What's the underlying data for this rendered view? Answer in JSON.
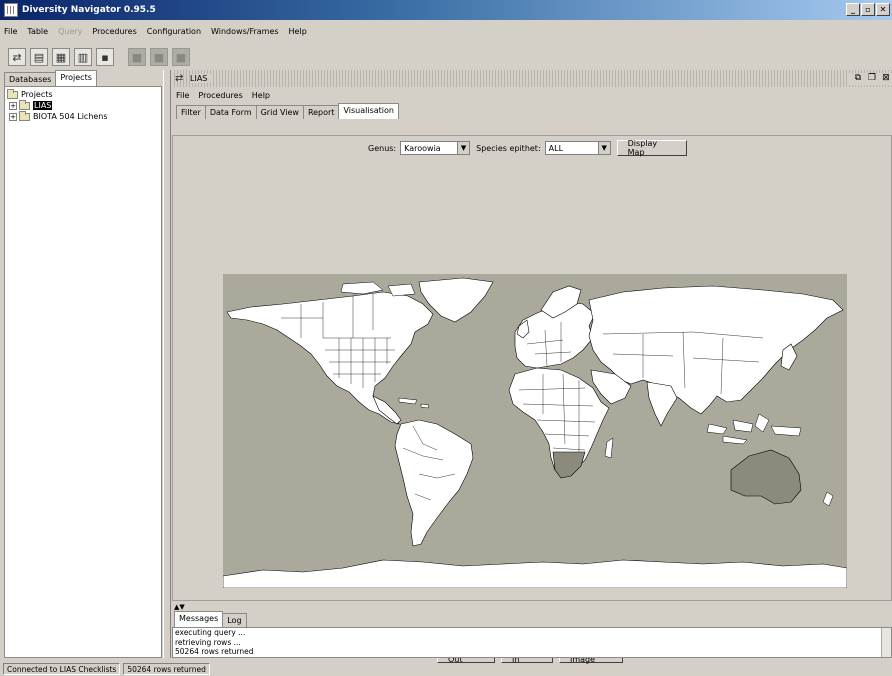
{
  "window": {
    "title": "Diversity Navigator 0.95.5",
    "buttons": [
      "_",
      "▫",
      "✕"
    ]
  },
  "menubar": [
    {
      "label": "File",
      "enabled": true
    },
    {
      "label": "Table",
      "enabled": true
    },
    {
      "label": "Query",
      "enabled": false
    },
    {
      "label": "Procedures",
      "enabled": true
    },
    {
      "label": "Configuration",
      "enabled": true
    },
    {
      "label": "Windows/Frames",
      "enabled": true
    },
    {
      "label": "Help",
      "enabled": true
    }
  ],
  "left_panel": {
    "tabs": [
      "Databases",
      "Projects"
    ],
    "active_tab": "Projects",
    "tree": {
      "root": "Projects",
      "items": [
        "LIAS",
        "BIOTA 504 Lichens"
      ]
    }
  },
  "frame": {
    "title": "LIAS",
    "menu": [
      "File",
      "Procedures",
      "Help"
    ],
    "tabs": [
      "Filter",
      "Data Form",
      "Grid View",
      "Report",
      "Visualisation"
    ],
    "active_tab": "Visualisation",
    "filter": {
      "genus_label": "Genus:",
      "genus_value": "Karoowia",
      "epithet_label": "Species epithet:",
      "epithet_value": "ALL",
      "display_map": "Display Map"
    },
    "map_buttons": {
      "zoom_out": "Zoom Out",
      "zoom_in": "Zoom In",
      "save_image": "Save Image"
    },
    "highlighted_regions": [
      "Southern Africa",
      "Australia"
    ],
    "colors": {
      "ocean": "#aaa99c",
      "land": "#ffffff",
      "highlight": "#8b8a7c",
      "border": "#000000"
    }
  },
  "messages": {
    "tabs": [
      "Messages",
      "Log"
    ],
    "active_tab": "Messages",
    "lines": [
      "executing query ...",
      "retrieving rows ...",
      "50264 rows returned"
    ]
  },
  "statusbar": {
    "connection": "Connected to LIAS Checklists",
    "rows": "50264 rows returned"
  }
}
